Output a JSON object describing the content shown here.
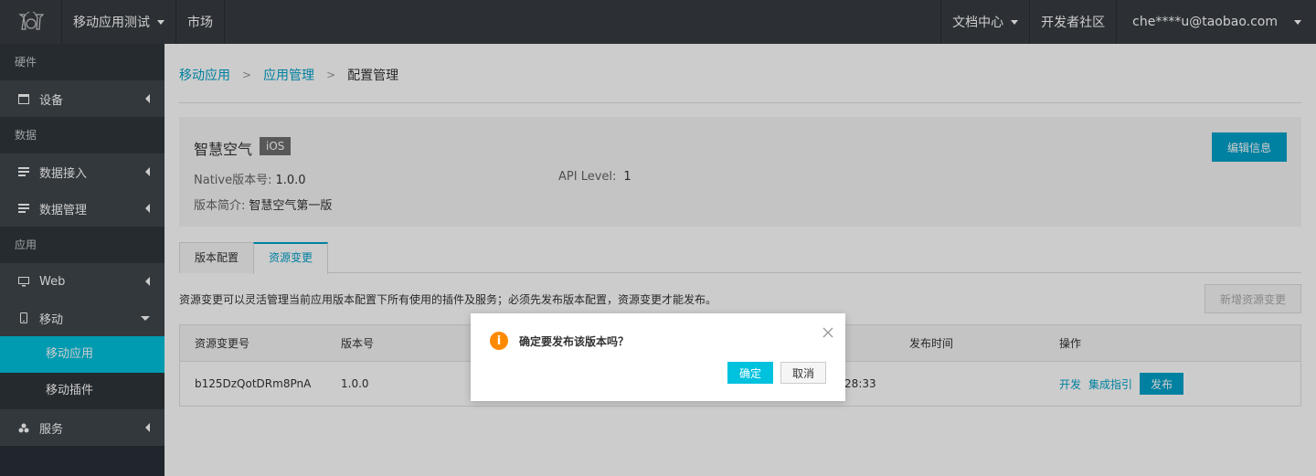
{
  "topbar": {
    "logo_icon": "iot-logo-icon",
    "app_menu": "移动应用测试",
    "market": "市场",
    "docs": "文档中心",
    "community": "开发者社区",
    "user": "che****u@taobao.com"
  },
  "sidebar": {
    "hardware_section": "硬件",
    "device": "设备",
    "data_section": "数据",
    "data_ingest": "数据接入",
    "data_manage": "数据管理",
    "app_section": "应用",
    "web": "Web",
    "mobile": "移动",
    "mobile_app": "移动应用",
    "mobile_plugin": "移动插件",
    "service": "服务"
  },
  "breadcrumb": {
    "item1": "移动应用",
    "item2": "应用管理",
    "current": "配置管理"
  },
  "info": {
    "name": "智慧空气",
    "platform": "iOS",
    "native_label": "Native版本号:",
    "native_value": "1.0.0",
    "api_label": "API Level:",
    "api_value": "1",
    "intro_label": "版本简介:",
    "intro_value": "智慧空气第一版",
    "edit_button": "编辑信息"
  },
  "tabs": {
    "tab1": "版本配置",
    "tab2": "资源变更"
  },
  "description": "资源变更可以灵活管理当前应用版本配置下所有使用的插件及服务；必须先发布版本配置，资源变更才能发布。",
  "new_button": "新增资源变更",
  "table": {
    "headers": {
      "id": "资源变更号",
      "version": "版本号",
      "publish_time": "发布时间",
      "ops": "操作"
    },
    "row": {
      "id": "b125DzQotDRm8PnA",
      "version": "1.0.0",
      "time_partial": ":28:33",
      "op_dev": "开发",
      "op_guide": "集成指引",
      "op_publish": "发布"
    }
  },
  "dialog": {
    "message": "确定要发布该版本吗？",
    "ok": "确定",
    "cancel": "取消",
    "warn_glyph": "i"
  }
}
